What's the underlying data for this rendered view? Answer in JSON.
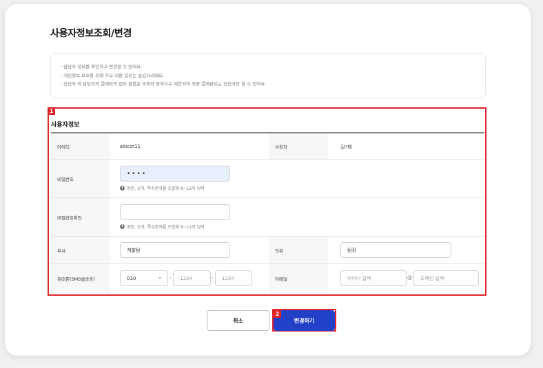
{
  "page": {
    "title": "사용자정보조회/변경"
  },
  "notice": {
    "lines": [
      "· 담당자 정보를 확인하고 변경할 수 있어요.",
      "· 개인정보 보호를 위해 주요 내용 일부는 숨김처리돼요.",
      "· 승인자 외 담당자와 결재자의 업무 권한은 조회와 등록으로 제한되며 최종 결재완료는 승인자만 할 수 있어요."
    ]
  },
  "section": {
    "badge": "1",
    "title": "사용자정보",
    "id_label": "아이디",
    "id_value": "sbicor11",
    "user_label": "사용자",
    "user_value": "김*재",
    "password_label": "비밀번호",
    "password_value": "••••",
    "password_hint": "영문, 숫자, 특수문자를 조합해 8~12자 입력",
    "password_confirm_label": "비밀번호확인",
    "password_confirm_value": "",
    "password_confirm_hint": "영문, 숫자, 특수문자를 조합해 8~12자 입력",
    "dept_label": "부서",
    "dept_value": "개발팀",
    "position_label": "직위",
    "position_value": "팀장",
    "phone_label": "휴대폰(SMS발송용)",
    "phone_prefix": "010",
    "phone_mid_placeholder": "1234",
    "phone_last_placeholder": "1234",
    "email_label": "이메일",
    "email_id_placeholder": "아이디 입력",
    "email_at": "@",
    "email_domain_placeholder": "도메인 입력",
    "hint_icon": "info-icon"
  },
  "buttons": {
    "cancel": "취소",
    "submit": "변경하기",
    "submit_badge": "2"
  },
  "colors": {
    "accent": "#2341c8",
    "highlight": "#e0242b",
    "password_fill": "#e8f0fe"
  }
}
